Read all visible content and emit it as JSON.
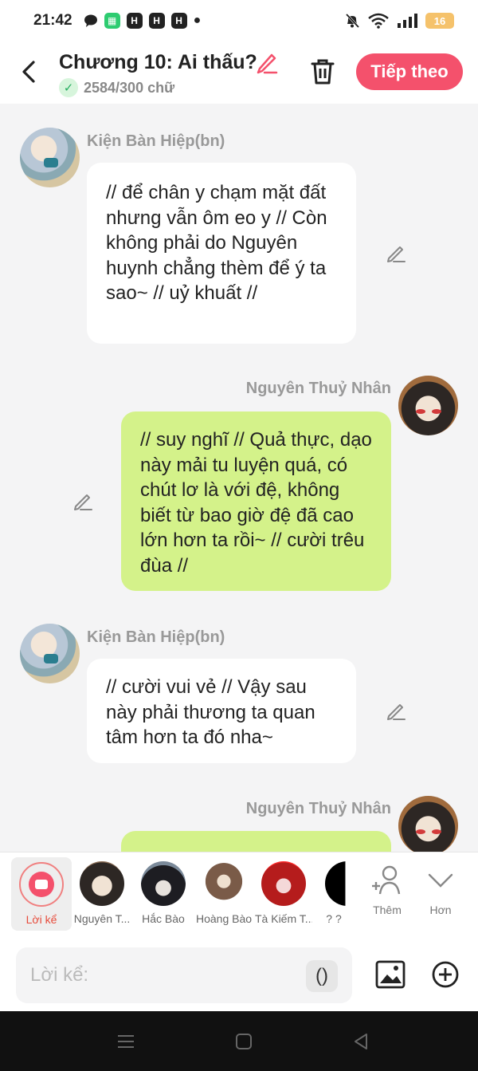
{
  "status": {
    "time": "21:42",
    "battery": "16"
  },
  "header": {
    "title": "Chương 10: Ai thấu?",
    "word_count": "2584/300 chữ",
    "next_label": "Tiếp theo"
  },
  "messages": [
    {
      "side": "left",
      "name": "Kiện Bàn Hiệp(bn)",
      "text": "// để chân y chạm mặt đất nhưng vẫn ôm eo y // Còn không phải do Nguyên huynh chẳng thèm để ý ta sao~ // uỷ khuất //"
    },
    {
      "side": "right",
      "name": "Nguyên Thuỷ Nhân",
      "text": "// suy nghĩ // Quả thực, dạo này mải tu luyện quá, có chút lơ là với đệ, không biết từ bao giờ đệ đã cao lớn hơn ta rồi~ // cười trêu đùa //"
    },
    {
      "side": "left",
      "name": "Kiện Bàn Hiệp(bn)",
      "text": "// cười vui vẻ // Vậy sau này phải thương ta quan tâm hơn ta đó nha~"
    },
    {
      "side": "right",
      "name": "Nguyên Thuỷ Nhân",
      "text": ""
    }
  ],
  "cast": [
    {
      "label": "Lời kể"
    },
    {
      "label": "Nguyên T..."
    },
    {
      "label": "Hắc Bào"
    },
    {
      "label": "Hoàng Bào"
    },
    {
      "label": "Tà Kiếm T..."
    },
    {
      "label": "? ?"
    }
  ],
  "cast_actions": {
    "add_label": "Thêm",
    "more_label": "Hơn"
  },
  "input": {
    "placeholder": "Lời kể:",
    "paren_label": "()"
  }
}
